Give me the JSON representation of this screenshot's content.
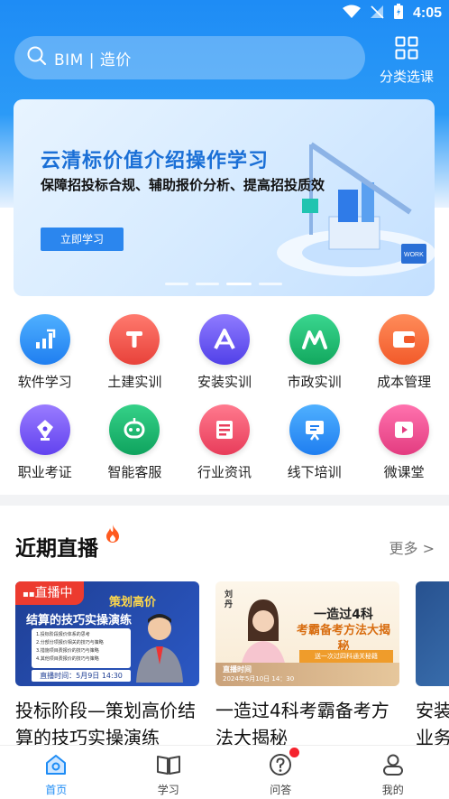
{
  "status_bar": {
    "time": "4:05"
  },
  "search": {
    "placeholder": "BIM | 造价"
  },
  "category": {
    "label": "分类选课"
  },
  "banner": {
    "title": "云清标价值介绍操作学习",
    "subtitle": "保障招投标合规、辅助报价分析、提高招投质效",
    "button_label": "立即学习",
    "art_label": "WORK",
    "pages": 4,
    "active_page": 3
  },
  "categories": [
    {
      "label": "软件学习",
      "icon": "chart-up-icon",
      "color": "#2f8cf3"
    },
    {
      "label": "土建实训",
      "icon": "letter-t-icon",
      "color": "#f0544b"
    },
    {
      "label": "安装实训",
      "icon": "letter-a-icon",
      "color": "#6a5cf2"
    },
    {
      "label": "市政实训",
      "icon": "letter-m-icon",
      "color": "#1fbf77"
    },
    {
      "label": "成本管理",
      "icon": "wallet-icon",
      "color": "#fb6b3f"
    },
    {
      "label": "职业考证",
      "icon": "pen-nib-icon",
      "color": "#7b5af5"
    },
    {
      "label": "智能客服",
      "icon": "robot-icon",
      "color": "#19b86f"
    },
    {
      "label": "行业资讯",
      "icon": "news-icon",
      "color": "#f2566e"
    },
    {
      "label": "线下培训",
      "icon": "presentation-icon",
      "color": "#2f8cf3"
    },
    {
      "label": "微课堂",
      "icon": "play-icon",
      "color": "#ee4a8c"
    }
  ],
  "live_section": {
    "title": "近期直播",
    "more": "更多 >"
  },
  "courses": [
    {
      "title": "投标阶段—策划高价结算的技巧实操演练",
      "live_tag": "直播中",
      "thumb_title_1": "策划高价",
      "thumb_title_2": "结算的技巧实操演练",
      "thumb_list": [
        "1.投标阶段报价体系的思考",
        "2.分部分项报价相关的技巧与策略",
        "3.措施项目费报价的技巧与策略",
        "4.其他项目费报价的技巧与策略"
      ],
      "thumb_time": "直播时间：5月9日 14:30"
    },
    {
      "title": "一造过4科考霸备考方法大揭秘",
      "thumb_name": "刘丹",
      "thumb_title_1": "一造过4科",
      "thumb_title_2": "考霸备考方法大揭秘",
      "thumb_sub": "送一次过四科通关秘籍",
      "thumb_time_label": "直播时间",
      "thumb_time": "2024年5月10日  14：30"
    },
    {
      "title": "安装业务"
    }
  ],
  "tabs": [
    {
      "label": "首页",
      "icon": "home-icon",
      "active": true
    },
    {
      "label": "学习",
      "icon": "book-icon",
      "active": false
    },
    {
      "label": "问答",
      "icon": "question-icon",
      "active": false,
      "badge": true
    },
    {
      "label": "我的",
      "icon": "user-icon",
      "active": false
    }
  ]
}
